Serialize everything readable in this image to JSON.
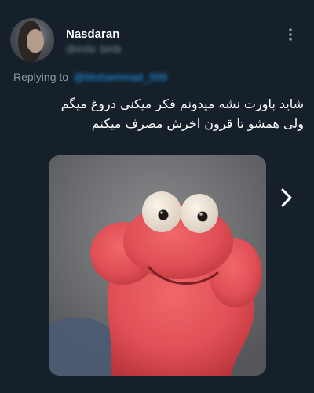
{
  "tweet": {
    "author_name": "Nasdaran",
    "author_handle": "@milo_bmb",
    "replying_to_label": "Replying to",
    "replying_to_handle": "@Mohammad_999",
    "text_lines": [
      "شاید باورت نشه میدونم فکر میکنی دروغ میگم",
      "ولی همشو تا قرون اخرش مصرف میکنم"
    ]
  },
  "icons": {
    "more": "more-vertical-icon",
    "next": "chevron-right-icon"
  },
  "colors": {
    "background": "#15202b",
    "text": "#ffffff",
    "secondary_text": "#8899a6",
    "link": "#1d9bf0"
  }
}
